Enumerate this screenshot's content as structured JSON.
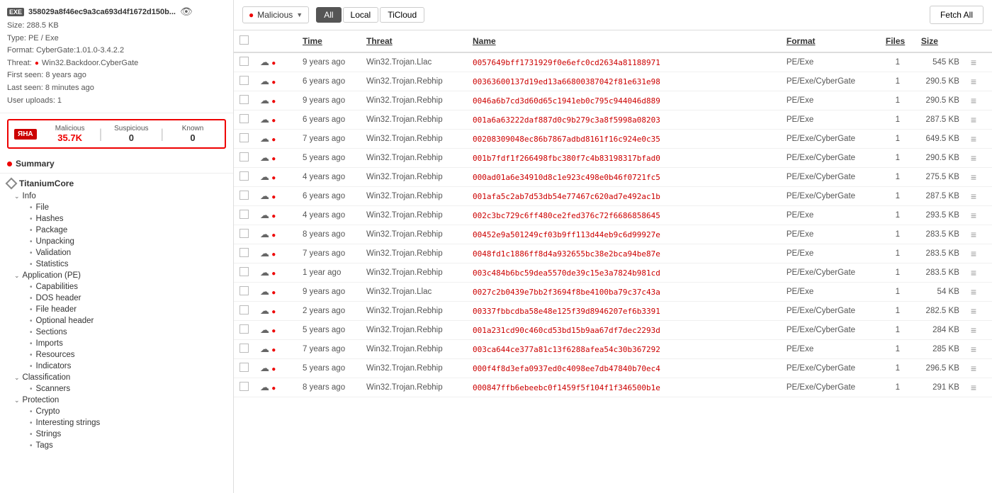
{
  "sidebar": {
    "file_badge": "EXE",
    "file_hash": "358029a8f46ec9a3ca693d4f1672d150b...",
    "file_size": "Size: 288.5 KB",
    "file_type": "Type: PE / Exe",
    "file_format": "Format: CyberGate:1.01.0-3.4.2.2",
    "file_threat": "Threat: Win32.Backdoor.CyberGate",
    "first_seen": "First seen: 8 years ago",
    "last_seen": "Last seen: 8 minutes ago",
    "user_uploads": "User uploads: 1",
    "yara_badge": "ЯHA",
    "stat_malicious_label": "Malicious",
    "stat_malicious_value": "35.7K",
    "stat_suspicious_label": "Suspicious",
    "stat_suspicious_value": "0",
    "stat_known_label": "Known",
    "stat_known_value": "0",
    "summary_label": "Summary",
    "titaniumcore_label": "TitaniumCore",
    "tree": {
      "info_label": "Info",
      "info_children": [
        "File",
        "Hashes",
        "Package",
        "Unpacking",
        "Validation",
        "Statistics"
      ],
      "application_label": "Application (PE)",
      "application_children": [
        "Capabilities",
        "DOS header",
        "File header",
        "Optional header",
        "Sections",
        "Imports",
        "Resources"
      ],
      "indicators_label": "Indicators",
      "classification_label": "Classification",
      "classification_children": [
        "Scanners"
      ],
      "protection_label": "Protection",
      "protection_children": [
        "Crypto"
      ],
      "interesting_strings_label": "Interesting strings",
      "strings_label": "Strings",
      "tags_label": "Tags"
    }
  },
  "toolbar": {
    "malicious_label": "Malicious",
    "filter_all": "All",
    "filter_local": "Local",
    "filter_ticloud": "TiCloud",
    "fetch_all_label": "Fetch All"
  },
  "table": {
    "col_time": "Time",
    "col_threat": "Threat",
    "col_name": "Name",
    "col_format": "Format",
    "col_files": "Files",
    "col_size": "Size",
    "rows": [
      {
        "time": "9 years ago",
        "threat": "Win32.Trojan.Llac",
        "name": "0057649bff1731929f0e6efc0cd2634a81188971",
        "format": "PE/Exe",
        "files": "1",
        "size": "545 KB"
      },
      {
        "time": "6 years ago",
        "threat": "Win32.Trojan.Rebhip",
        "name": "00363600137d19ed13a66800387042f81e631e98",
        "format": "PE/Exe/CyberGate",
        "files": "1",
        "size": "290.5 KB"
      },
      {
        "time": "9 years ago",
        "threat": "Win32.Trojan.Rebhip",
        "name": "0046a6b7cd3d60d65c1941eb0c795c944046d889",
        "format": "PE/Exe",
        "files": "1",
        "size": "290.5 KB"
      },
      {
        "time": "6 years ago",
        "threat": "Win32.Trojan.Rebhip",
        "name": "001a6a63222daf887d0c9b279c3a8f5998a08203",
        "format": "PE/Exe",
        "files": "1",
        "size": "287.5 KB"
      },
      {
        "time": "7 years ago",
        "threat": "Win32.Trojan.Rebhip",
        "name": "00208309048ec86b7867adbd8161f16c924e0c35",
        "format": "PE/Exe/CyberGate",
        "files": "1",
        "size": "649.5 KB"
      },
      {
        "time": "5 years ago",
        "threat": "Win32.Trojan.Rebhip",
        "name": "001b7fdf1f266498fbc380f7c4b83198317bfad0",
        "format": "PE/Exe/CyberGate",
        "files": "1",
        "size": "290.5 KB"
      },
      {
        "time": "4 years ago",
        "threat": "Win32.Trojan.Rebhip",
        "name": "000ad01a6e34910d8c1e923c498e0b46f0721fc5",
        "format": "PE/Exe/CyberGate",
        "files": "1",
        "size": "275.5 KB"
      },
      {
        "time": "6 years ago",
        "threat": "Win32.Trojan.Rebhip",
        "name": "001afa5c2ab7d53db54e77467c620ad7e492ac1b",
        "format": "PE/Exe/CyberGate",
        "files": "1",
        "size": "287.5 KB"
      },
      {
        "time": "4 years ago",
        "threat": "Win32.Trojan.Rebhip",
        "name": "002c3bc729c6ff480ce2fed376c72f6686858645",
        "format": "PE/Exe",
        "files": "1",
        "size": "293.5 KB"
      },
      {
        "time": "8 years ago",
        "threat": "Win32.Trojan.Rebhip",
        "name": "00452e9a501249cf03b9ff113d44eb9c6d99927e",
        "format": "PE/Exe",
        "files": "1",
        "size": "283.5 KB"
      },
      {
        "time": "7 years ago",
        "threat": "Win32.Trojan.Rebhip",
        "name": "0048fd1c1886ff8d4a932655bc38e2bca94be87e",
        "format": "PE/Exe",
        "files": "1",
        "size": "283.5 KB"
      },
      {
        "time": "1 year ago",
        "threat": "Win32.Trojan.Rebhip",
        "name": "003c484b6bc59dea5570de39c15e3a7824b981cd",
        "format": "PE/Exe/CyberGate",
        "files": "1",
        "size": "283.5 KB"
      },
      {
        "time": "9 years ago",
        "threat": "Win32.Trojan.Llac",
        "name": "0027c2b0439e7bb2f3694f8be4100ba79c37c43a",
        "format": "PE/Exe",
        "files": "1",
        "size": "54 KB"
      },
      {
        "time": "2 years ago",
        "threat": "Win32.Trojan.Rebhip",
        "name": "00337fbbcdba58e48e125f39d8946207ef6b3391",
        "format": "PE/Exe/CyberGate",
        "files": "1",
        "size": "282.5 KB"
      },
      {
        "time": "5 years ago",
        "threat": "Win32.Trojan.Rebhip",
        "name": "001a231cd90c460cd53bd15b9aa67df7dec2293d",
        "format": "PE/Exe/CyberGate",
        "files": "1",
        "size": "284 KB"
      },
      {
        "time": "7 years ago",
        "threat": "Win32.Trojan.Rebhip",
        "name": "003ca644ce377a81c13f6288afea54c30b367292",
        "format": "PE/Exe",
        "files": "1",
        "size": "285 KB"
      },
      {
        "time": "5 years ago",
        "threat": "Win32.Trojan.Rebhip",
        "name": "000f4f8d3efa0937ed0c4098ee7db47840b70ec4",
        "format": "PE/Exe/CyberGate",
        "files": "1",
        "size": "296.5 KB"
      },
      {
        "time": "8 years ago",
        "threat": "Win32.Trojan.Rebhip",
        "name": "000847ffb6ebeebc0f1459f5f104f1f346500b1e",
        "format": "PE/Exe/CyberGate",
        "files": "1",
        "size": "291 KB"
      }
    ]
  }
}
